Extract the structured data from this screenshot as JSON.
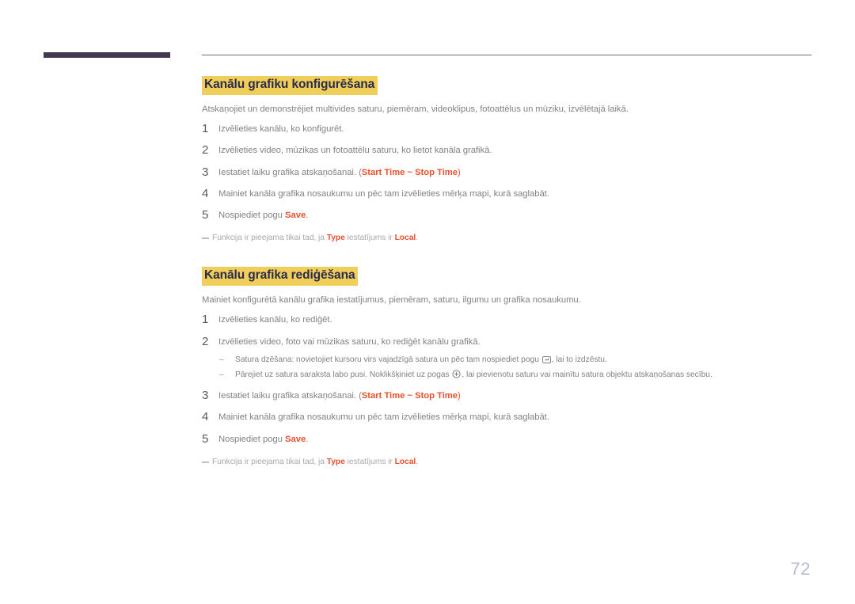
{
  "document": {
    "page_number": "72",
    "accent_highlight_color": "#EFCE5A",
    "accent_orange_color": "#E8512F",
    "heading_text_color": "#2B2B4E",
    "body_text_color": "#808285",
    "header_bar_color": "#433A52"
  },
  "sections": [
    {
      "title": "Kanālu grafiku konfigurēšana",
      "intro": "Atskaņojiet un demonstrējiet multivides saturu, piemēram, videoklipus, fotoattēlus un mūziku, izvēlētajā laikā.",
      "steps": [
        {
          "number": "1",
          "text_before": "Izvēlieties kanālu, ko konfigurēt.",
          "parts": []
        },
        {
          "number": "2",
          "text_before": "Izvēlieties video, mūzikas un fotoattēlu saturu, ko lietot kanāla grafikā.",
          "parts": []
        },
        {
          "number": "3",
          "text_before": "Iestatiet laiku grafika atskaņošanai. (",
          "term_1": "Start Time",
          "separator": " ~ ",
          "term_2": "Stop Time",
          "text_after": ")"
        },
        {
          "number": "4",
          "text_before": "Mainiet kanāla grafika nosaukumu un pēc tam izvēlieties mērķa mapi, kurā saglabāt.",
          "parts": []
        },
        {
          "number": "5",
          "text_before": "Nospiediet pogu ",
          "term_1": "Save",
          "text_after": "."
        }
      ],
      "note": {
        "text_before": "Funkcija ir pieejama tikai tad, ja ",
        "term_1": "Type",
        "text_middle": " iestatījums ir ",
        "term_2": "Local",
        "text_after": "."
      }
    },
    {
      "title": "Kanālu grafika rediģēšana",
      "intro": "Mainiet konfigurētā kanālu grafika iestatījumus, piemēram, saturu, ilgumu un grafika nosaukumu.",
      "steps": [
        {
          "number": "1",
          "text_before": "Izvēlieties kanālu, ko rediģēt.",
          "parts": []
        },
        {
          "number": "2",
          "text_before": "Izvēlieties video, foto vai mūzikas saturu, ko rediģēt kanālu grafikā.",
          "subbullets": [
            {
              "dash": "–",
              "text_before": "Satura dzēšana: novietojiet kursoru virs vajadzīgā satura un pēc tam nospiediet pogu ",
              "icon": "enter-key-icon",
              "text_after": ", lai to izdzēstu."
            },
            {
              "dash": "–",
              "text_before": "Pārejiet uz satura saraksta labo pusi. Noklikšķiniet uz pogas ",
              "icon": "circled-plus-icon",
              "text_after": ", lai pievienotu saturu vai mainītu satura objektu atskaņošanas secību."
            }
          ]
        },
        {
          "number": "3",
          "text_before": "Iestatiet laiku grafika atskaņošanai. (",
          "term_1": "Start Time",
          "separator": " ~ ",
          "term_2": "Stop Time",
          "text_after": ")"
        },
        {
          "number": "4",
          "text_before": "Mainiet kanāla grafika nosaukumu un pēc tam izvēlieties mērķa mapi, kurā saglabāt.",
          "parts": []
        },
        {
          "number": "5",
          "text_before": "Nospiediet pogu ",
          "term_1": "Save",
          "text_after": "."
        }
      ],
      "note": {
        "text_before": "Funkcija ir pieejama tikai tad, ja ",
        "term_1": "Type",
        "text_middle": " iestatījums ir ",
        "term_2": "Local",
        "text_after": "."
      }
    }
  ]
}
